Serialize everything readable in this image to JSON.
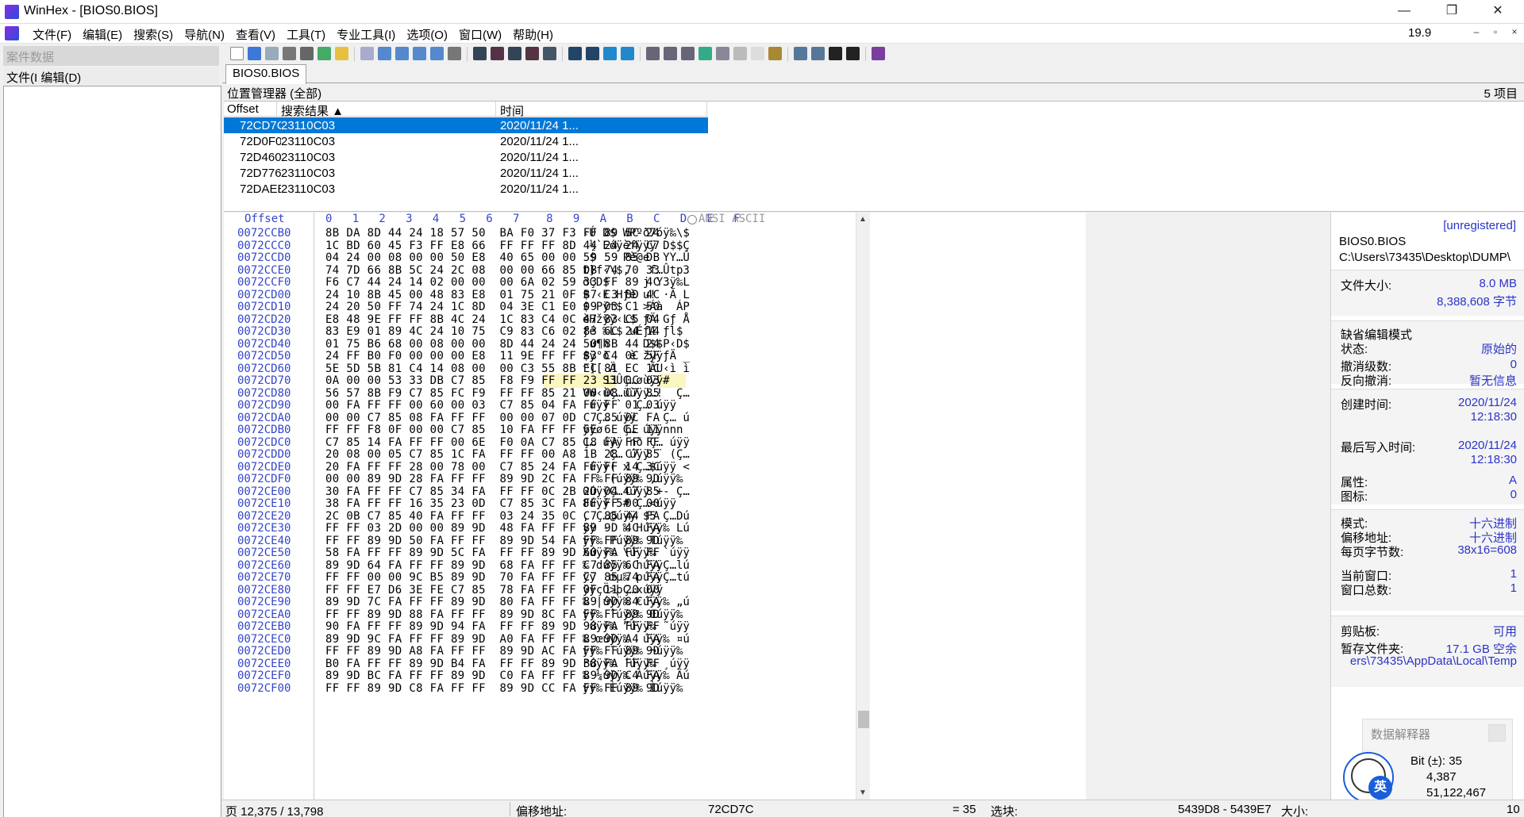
{
  "window": {
    "title": "WinHex - [BIOS0.BIOS]",
    "minimize": "—",
    "restore": "❐",
    "close": "✕"
  },
  "menu": {
    "items": [
      "文件(F)",
      "编辑(E)",
      "搜索(S)",
      "导航(N)",
      "查看(V)",
      "工具(T)",
      "专业工具(I)",
      "选项(O)",
      "窗口(W)",
      "帮助(H)"
    ],
    "zoom": "19.9",
    "child_min": "–",
    "child_restore": "▫",
    "child_close": "×"
  },
  "left": {
    "case_data": "案件数据",
    "file_menu": "文件(I 编辑(D)"
  },
  "tab": {
    "label": "BIOS0.BIOS"
  },
  "position_manager": {
    "title": "位置管理器 (全部)",
    "count": "5 项目",
    "columns": [
      "Offset",
      "搜索结果 ▲",
      "时间"
    ],
    "rows": [
      [
        "72CD7C",
        "23110C03",
        "2020/11/24   1..."
      ],
      [
        "72D0F0",
        "23110C03",
        "2020/11/24   1..."
      ],
      [
        "72D460",
        "23110C03",
        "2020/11/24   1..."
      ],
      [
        "72D776",
        "23110C03",
        "2020/11/24   1..."
      ],
      [
        "72DAEE",
        "23110C03",
        "2020/11/24   1..."
      ]
    ]
  },
  "hex": {
    "offset_header": "Offset",
    "col_header": "0   1   2   3   4   5   6   7    8   9   A   B   C   D   E   F",
    "ascii_header": "ANSI ASCII",
    "rows": [
      [
        "0072CCB0",
        "8B DA 8D 44 24 18 57 50  BA F0 37 F3 FF 89 5C 24",
        "‹Ú D$ WPºð7óÿ‰\\$"
      ],
      [
        "0072CCC0",
        "1C BD 60 45 F3 FF E8 66  FF FF FF 8D 44 24 24 C7",
        " ½`Eóÿèfÿÿÿ D$$Ç"
      ],
      [
        "0072CCD0",
        "04 24 00 08 00 00 50 E8  40 65 00 00 59 59 85 DB",
        " $    Pè@e  YY…Û"
      ],
      [
        "0072CCE0",
        "74 7D 66 8B 5C 24 2C 08  00 00 66 85 DB 74 70 33",
        "t}f‹\\$,   f…Ûtp3"
      ],
      [
        "0072CCF0",
        "F6 C7 44 24 14 02 00 00  00 6A 02 59 33 FF 89 4C",
        "öÇD$     j Y3ÿ‰L"
      ],
      [
        "0072CD00",
        "24 10 8B 45 00 48 83 E8  01 75 21 0F B7 C3 8D 4C",
        "$ ‹E Hƒè u! ·Ã L"
      ],
      [
        "0072CD10",
        "24 20 50 FF 74 24 1C 8D  04 3E C1 E0 09 03 C1 50",
        "$ Pÿt$   >Áà  ÁP"
      ],
      [
        "0072CD20",
        "E8 48 9E FF FF 8B 4C 24  1C 83 C4 0C 47 83 C5 04",
        "èHžÿÿ‹L$ ƒÄ Gƒ Å"
      ],
      [
        "0072CD30",
        "83 E9 01 89 4C 24 10 75  C9 83 C6 02 83 6C 24 14",
        "ƒé ‰L$ uÉƒÆ ƒl$ "
      ],
      [
        "0072CD40",
        "01 75 B6 68 00 08 00 00  8D 44 24 24 50 8B 44 24",
        " u¶h     D$$P‹D$"
      ],
      [
        "0072CD50",
        "24 FF B0 F0 00 00 00 E8  11 9E FF FF 83 C4 0C 5F",
        "$ÿ°ð   è žÿÿƒÄ _"
      ],
      [
        "0072CD60",
        "5E 5D 5B 81 C4 14 08 00  00 C3 55 8B EC 81 EC 1C",
        "^][ Ä     ÃU‹ì ì "
      ],
      [
        "0072CD70",
        "0A 00 00 53 33 DB C7 85  F8 F9 FF FF 23 11 0C 03",
        "   S3ÛÇ…øùÿÿ#   "
      ],
      [
        "0072CD80",
        "56 57 8B F9 C7 85 FC F9  FF FF 85 21 00 08 C7 85",
        "VW‹ùÇ…üùÿÿ…!  Ç…"
      ],
      [
        "0072CD90",
        "00 FA FF FF 00 60 00 03  C7 85 04 FA FF FF 01 03",
        " úÿÿ `  Ç… úÿÿ  "
      ],
      [
        "0072CDA0",
        "00 00 C7 85 08 FA FF FF  00 00 07 0D C7 85 0C FA",
        "  Ç… úÿÿ    Ç… ú"
      ],
      [
        "0072CDB0",
        "FF FF F8 0F 00 00 C7 85  10 FA FF FF 6E 6E 6E 11",
        "ÿÿø   Ç… úÿÿnnn "
      ],
      [
        "0072CDC0",
        "C7 85 14 FA FF FF 00 6E  F0 0A C7 85 18 FA FF FF",
        "Ç… úÿÿ nð Ç… úÿÿ"
      ],
      [
        "0072CDD0",
        "20 08 00 05 C7 85 1C FA  FF FF 00 A8 1B 28 C7 85",
        "    Ç… úÿÿ ¨ (Ç…"
      ],
      [
        "0072CDE0",
        "20 FA FF FF 28 00 78 00  C7 85 24 FA FF FF 14 3C",
        " úÿÿ( x Ç…$úÿÿ <"
      ],
      [
        "0072CDF0",
        "00 00 89 9D 28 FA FF FF  89 9D 2C FA FF FF 89 9D",
        "  ‰ (úÿÿ‰ ,úÿÿ‰ "
      ],
      [
        "0072CE00",
        "30 FA FF FF C7 85 34 FA  FF FF 0C 2B 2D 04 C7 85",
        "0úÿÿÇ…4úÿÿ +- Ç…"
      ],
      [
        "0072CE10",
        "38 FA FF FF 16 35 23 0D  C7 85 3C FA FF FF 00 00",
        "8úÿÿ 5# Ç…<úÿÿ  "
      ],
      [
        "0072CE20",
        "2C 0B C7 85 40 FA FF FF  03 24 35 0C C7 85 44 FA",
        ", Ç…@úÿÿ $5 Ç…Dú"
      ],
      [
        "0072CE30",
        "FF FF 03 2D 00 00 89 9D  48 FA FF FF 89 9D 4C FA",
        "ÿÿ -  ‰ Húÿÿ‰ Lú"
      ],
      [
        "0072CE40",
        "FF FF 89 9D 50 FA FF FF  89 9D 54 FA FF FF 89 9D",
        "ÿÿ‰ Púÿÿ‰ Túÿÿ‰ "
      ],
      [
        "0072CE50",
        "58 FA FF FF 89 9D 5C FA  FF FF 89 9D 60 FA FF FF",
        "Xúÿÿ‰ \\úÿÿ‰ `úÿÿ"
      ],
      [
        "0072CE60",
        "89 9D 64 FA FF FF 89 9D  68 FA FF FF C7 85 6C FA",
        "‰ dúÿÿ‰ húÿÿÇ…lú"
      ],
      [
        "0072CE70",
        "FF FF 00 00 9C B5 89 9D  70 FA FF FF C7 85 74 FA",
        "ÿÿ  œµ‰ púÿÿÇ…tú"
      ],
      [
        "0072CE80",
        "FF FF E7 D6 3E FE C7 85  78 FA FF FF 0F 11 20 00",
        "ÿÿçÖ>þÇ…xúÿÿ    "
      ],
      [
        "0072CE90",
        "89 9D 7C FA FF FF 89 9D  80 FA FF FF 89 9D 84 FA",
        "‰ |úÿÿ‰ €úÿÿ‰ „ú"
      ],
      [
        "0072CEA0",
        "FF FF 89 9D 88 FA FF FF  89 9D 8C FA FF FF 89 9D",
        "ÿÿ‰ ˆúÿÿ‰ Œúÿÿ‰ "
      ],
      [
        "0072CEB0",
        "90 FA FF FF 89 9D 94 FA  FF FF 89 9D 98 FA FF FF",
        " úÿÿ‰ ”úÿÿ‰ ˜úÿÿ"
      ],
      [
        "0072CEC0",
        "89 9D 9C FA FF FF 89 9D  A0 FA FF FF 89 9D A4 FA",
        "‰ œúÿÿ‰  úÿÿ‰ ¤ú"
      ],
      [
        "0072CED0",
        "FF FF 89 9D A8 FA FF FF  89 9D AC FA FF FF 89 9D",
        "ÿÿ‰ ¨úÿÿ‰ ¬úÿÿ‰ "
      ],
      [
        "0072CEE0",
        "B0 FA FF FF 89 9D B4 FA  FF FF 89 9D B8 FA FF FF",
        "°úÿÿ‰ ´úÿÿ‰ ¸úÿÿ"
      ],
      [
        "0072CEF0",
        "89 9D BC FA FF FF 89 9D  C0 FA FF FF 89 9D C4 FA",
        "‰ ¼úÿÿ‰ Àúÿÿ‰ Äú"
      ],
      [
        "0072CF00",
        "FF FF 89 9D C8 FA FF FF  89 9D CC FA FF FF 89 9D",
        "ÿÿ‰ Èúÿÿ‰ Ìúÿÿ‰ "
      ]
    ]
  },
  "info": {
    "unregistered": "[unregistered]",
    "filename": "BIOS0.BIOS",
    "path": "C:\\Users\\73435\\Desktop\\DUMP\\",
    "file_size_label": "文件大小:",
    "file_size_mb": "8.0 MB",
    "file_size_bytes": "8,388,608 字节",
    "default_edit_mode": "缺省编辑模式",
    "state_label": "状态:",
    "state_value": "原始的",
    "undo_level_label": "撤消级数:",
    "undo_level_value": "0",
    "reverse_undo_label": "反向撤消:",
    "reverse_undo_value": "暂无信息",
    "created_label": "创建时间:",
    "created_date": "2020/11/24",
    "created_time": "12:18:30",
    "lastwrite_label": "最后写入时间:",
    "lastwrite_date": "2020/11/24",
    "lastwrite_time": "12:18:30",
    "attr_label": "属性:",
    "attr_value": "A",
    "icon_label": "图标:",
    "icon_value": "0",
    "mode_label": "模式:",
    "mode_value": "十六进制",
    "offset_label": "偏移地址:",
    "offset_value": "十六进制",
    "bytes_per_page_label": "每页字节数:",
    "bytes_per_page_value": "38x16=608",
    "current_window_label": "当前窗口:",
    "current_window_value": "1",
    "window_total_label": "窗口总数:",
    "window_total_value": "1",
    "clipboard_label": "剪贴板:",
    "clipboard_value": "可用",
    "temp_label": "暂存文件夹:",
    "temp_value": "17.1 GB 空余",
    "temp_path": "ers\\73435\\AppData\\Local\\Temp"
  },
  "interpreter": {
    "title": "数据解释器",
    "line1": "Bit (±): 35",
    "line2": "4,387",
    "line3": "51,122,467",
    "ime_label": "英"
  },
  "status": {
    "page": "页 12,375 / 13,798",
    "offset_label": "偏移地址:",
    "offset_value": "72CD7C",
    "value": "= 35",
    "block_label": "选块:",
    "block_value": "5439D8 - 5439E7",
    "size_label": "大小:",
    "size_value": "10"
  }
}
